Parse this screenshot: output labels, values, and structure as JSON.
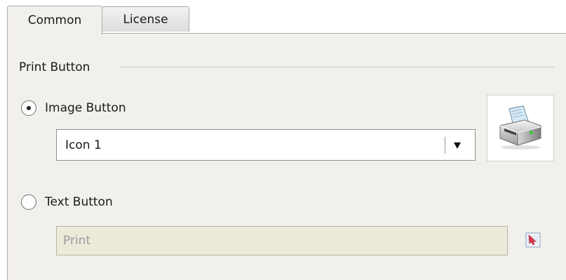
{
  "tabs": [
    {
      "label": "Common",
      "active": true
    },
    {
      "label": "License",
      "active": false
    }
  ],
  "print_button_group": {
    "title": "Print Button",
    "image_button": {
      "label": "Image Button",
      "selected": true,
      "icon_select": {
        "value": "Icon 1"
      },
      "preview_icon": "printer-icon"
    },
    "text_button": {
      "label": "Text Button",
      "selected": false,
      "text_field": {
        "placeholder": "Print",
        "value": "",
        "disabled": true
      },
      "picker_icon": "color-picker-icon"
    }
  },
  "colors": {
    "panel_bg": "#f2f0ec",
    "disabled_input_bg": "#ecead9",
    "picker_arrow": "#e0364a"
  }
}
